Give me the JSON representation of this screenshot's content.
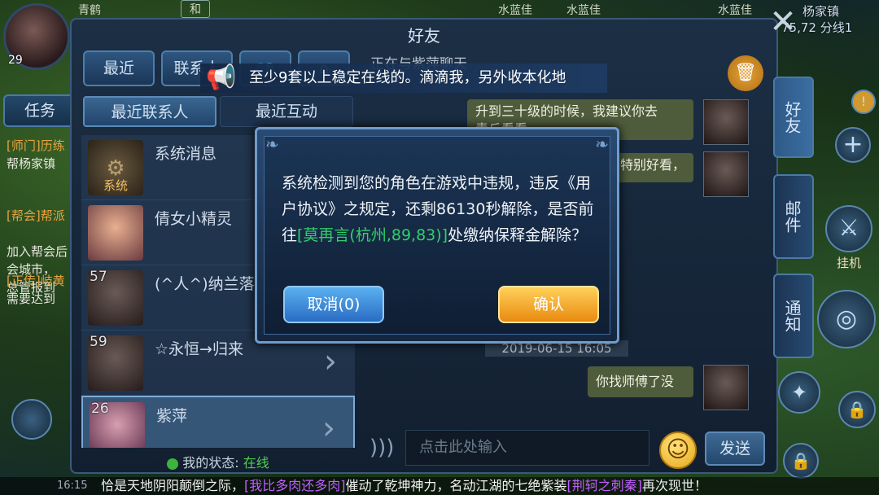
{
  "topbar": {
    "player_name": "青鹤",
    "badge": "和",
    "npc1": "水蓝佳",
    "npc2": "水蓝佳",
    "npc3": "水蓝佳"
  },
  "player": {
    "level": "29"
  },
  "location": {
    "name": "杨家镇",
    "coords": "75,72 分线1"
  },
  "sidebar": {
    "task_tab": "任务",
    "quests": [
      {
        "tag": "[师门]",
        "title": "历练",
        "desc": "帮杨家镇"
      },
      {
        "tag": "[帮会]",
        "title": "帮派",
        "desc": "加入帮会后\n会城市，\n总管报到"
      },
      {
        "tag": "[正传]",
        "title": "岐黄",
        "desc": "需要达到"
      }
    ]
  },
  "panel": {
    "title": "好友",
    "chatting_with": "正在与紫萍聊天",
    "tabs": [
      "最近",
      "联系人",
      "",
      ""
    ],
    "subtabs": [
      "最近联系人",
      "最近互动"
    ]
  },
  "contacts": [
    {
      "name": "系统消息",
      "avatar_label": "系统",
      "level": ""
    },
    {
      "name": "倩女小精灵",
      "level": ""
    },
    {
      "name": "(^人^)纳兰落日",
      "level": "57"
    },
    {
      "name": "☆永恒→归来",
      "level": "59"
    },
    {
      "name": "紫萍",
      "level": "26"
    }
  ],
  "my_status": {
    "label": "我的状态:",
    "value": "在线"
  },
  "announcement": "至少9套以上稳定在线的。滴滴我，另外收本化地",
  "chat": {
    "messages": [
      "升到三十级的时候，我建议你去\n青丘看看",
      "特别好看，",
      "你找师傅了没"
    ],
    "date": "2019-06-15 16:05",
    "input_placeholder": "点击此处输入",
    "send_label": "发送"
  },
  "side_tabs": [
    "好友",
    "邮件",
    "通知"
  ],
  "right_hud": {
    "hang_label": "挂机"
  },
  "dialog": {
    "text_before": "系统检测到您的角色在游戏中违规，违反《用户协议》之规定，还剩86130秒解除，是否前往",
    "link": "[莫再言(杭州,89,83)]",
    "text_after": "处缴纳保释金解除？",
    "cancel_label": "取消(0)",
    "ok_label": "确认"
  },
  "broadcast": {
    "time": "16:15",
    "part1": "恰是天地阴阳颠倒之际，",
    "player": "[我比多肉还多肉]",
    "part2": "催动了乾坤神力，名动江湖的七绝紫装",
    "item": "[荆轲之刺秦]",
    "part3": "再次现世！"
  }
}
